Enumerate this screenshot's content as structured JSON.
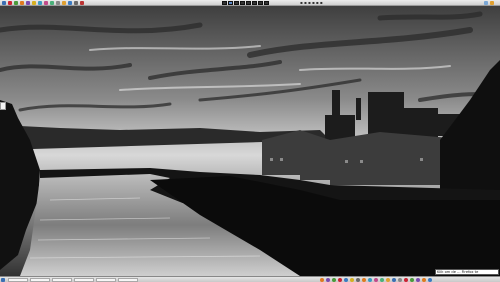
{
  "desktop": {
    "wallpaper": "black-and-white photo of a river at sunset with a town and factory chimney on the right bank"
  },
  "top_panel": {
    "launcher_icons": [
      "app-icon",
      "app-icon",
      "app-icon",
      "app-icon",
      "app-icon",
      "app-icon",
      "app-icon",
      "app-icon",
      "app-icon",
      "app-icon",
      "app-icon",
      "app-icon",
      "app-icon",
      "app-icon"
    ],
    "workspaces": [
      {
        "name": "workspace-1",
        "active": false
      },
      {
        "name": "workspace-2",
        "active": true
      },
      {
        "name": "workspace-3",
        "active": false
      },
      {
        "name": "workspace-4",
        "active": false
      },
      {
        "name": "workspace-5",
        "active": false
      },
      {
        "name": "workspace-6",
        "active": false
      },
      {
        "name": "workspace-7",
        "active": false
      },
      {
        "name": "workspace-8",
        "active": false
      }
    ]
  },
  "bottom_panel": {
    "tasks": 6,
    "status_text": "Klik om de ... Firefox te"
  },
  "colors": {
    "panel": "#dcdcdc",
    "accent": "#5a87c8"
  }
}
